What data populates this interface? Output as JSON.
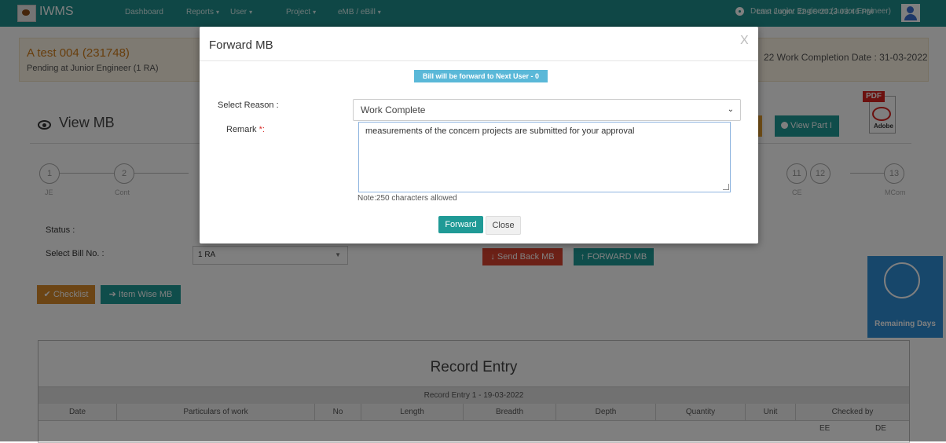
{
  "navbar": {
    "brand": "IWMS",
    "items": [
      {
        "label": "Dashboard",
        "caret": ""
      },
      {
        "label": "Reports",
        "caret": "▾"
      },
      {
        "label": "User",
        "caret": "▾"
      },
      {
        "label": "Project",
        "caret": "▾"
      },
      {
        "label": "eMB / eBill",
        "caret": "▾"
      }
    ],
    "last_login": "Last Login:  22-08-2023 03:46 PM",
    "user": "Demo Junior Engineer (Junior Engineer)"
  },
  "project": {
    "title": "A test 004  (231748)",
    "pending": "Pending at Junior Engineer (1 RA)",
    "right_info": "22  Work Completion Date : 31-03-2022"
  },
  "page": {
    "title": "View MB",
    "view_part_button": "View Part I",
    "pdf_tag": "PDF",
    "pdf_brand": "Adobe"
  },
  "workflow": {
    "steps": [
      {
        "num": "1",
        "label": "JE"
      },
      {
        "num": "2",
        "label": "Cont"
      },
      {
        "num": "11",
        "label": "CE"
      },
      {
        "num": "12",
        "label": ""
      },
      {
        "num": "13",
        "label": "MCom"
      }
    ]
  },
  "form": {
    "status_label": "Status :",
    "bill_label": "Select Bill No. :",
    "bill_value": "1 RA",
    "send_back_button": "Send Back MB",
    "forward_button": "FORWARD MB",
    "checklist_button": "Checklist",
    "itemwise_button": "Item Wise MB"
  },
  "remaining": {
    "label": "Remaining Days"
  },
  "record": {
    "title": "Record Entry",
    "subtitle": "Record Entry 1 - 19-03-2022",
    "columns": [
      "Date",
      "Particulars of work",
      "No",
      "Length",
      "Breadth",
      "Depth",
      "Quantity",
      "Unit",
      "Checked by"
    ],
    "checked_by_sub": [
      "EE",
      "DE"
    ]
  },
  "modal": {
    "title": "Forward MB",
    "close_glyph": "X",
    "info_badge": "Bill will be forward to Next User - 0",
    "reason_label": "Select Reason :",
    "reason_value": "Work Complete",
    "remark_label": "Remark",
    "remark_required": "*:",
    "remark_text": "measurements of the concern projects are submitted for your approval",
    "note": "Note:250 characters allowed",
    "forward_button": "Forward",
    "close_button": "Close"
  },
  "colors": {
    "teal": "#1f8f8c",
    "orange": "#d88a2a",
    "red": "#d9432f",
    "blue": "#2f8ed6"
  }
}
